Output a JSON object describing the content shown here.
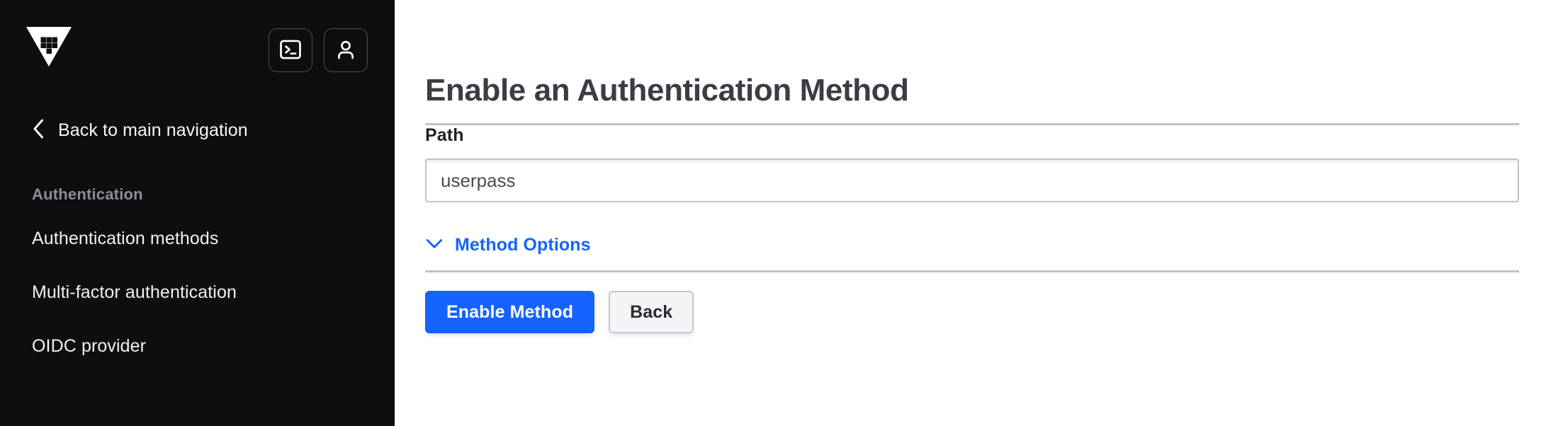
{
  "sidebar": {
    "logo_icon": "vault-logo-icon",
    "top_actions": [
      {
        "name": "console-toggle-button",
        "icon": "terminal-icon"
      },
      {
        "name": "user-menu-button",
        "icon": "user-icon"
      }
    ],
    "back_nav": {
      "icon": "chevron-left-icon",
      "label": "Back to main navigation"
    },
    "section_title": "Authentication",
    "items": [
      {
        "label": "Authentication methods"
      },
      {
        "label": "Multi-factor authentication"
      },
      {
        "label": "OIDC provider"
      }
    ]
  },
  "main": {
    "title": "Enable an Authentication Method",
    "path_field": {
      "label": "Path",
      "value": "userpass",
      "placeholder": "path"
    },
    "method_options": {
      "label": "Method Options",
      "icon": "chevron-down-icon",
      "expanded": false
    },
    "buttons": {
      "primary": "Enable Method",
      "secondary": "Back"
    }
  },
  "colors": {
    "accent_blue": "#1563FF",
    "sidebar_bg": "#0E0E11",
    "divider": "#BFC3CF",
    "title_text": "#3B3D45",
    "muted_text": "#8C8C95"
  }
}
